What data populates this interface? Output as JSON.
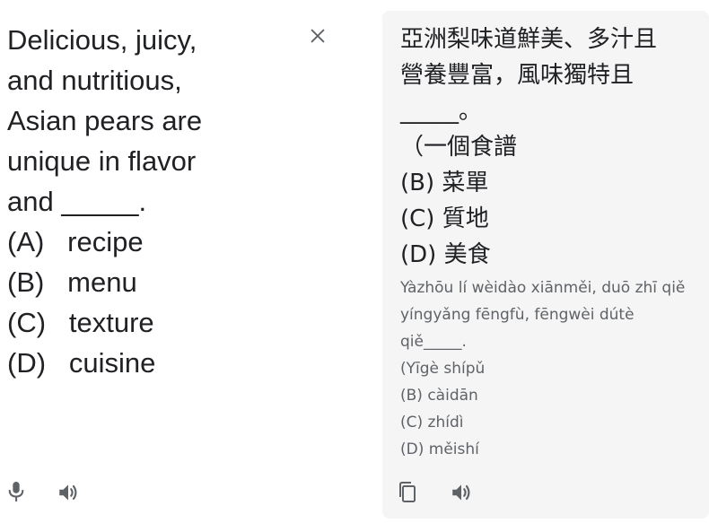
{
  "source": {
    "text": "Delicious, juicy,\nand nutritious,\nAsian pears are\nunique in flavor\nand _____.\n(A)   recipe\n(B)   menu\n(C)   texture\n(D)   cuisine"
  },
  "target": {
    "text": "亞洲梨味道鮮美、多汁且\n營養豐富，風味獨特且\n_____。\n（一個食譜\n(B) 菜單\n(C) 質地\n(D) 美食",
    "transliteration": "Yàzhōu lí wèidào xiānměi, duō zhī qiě\nyíngyǎng fēngfù, fēngwèi dútè\nqiě_____.\n(Yīgè shípǔ\n(B) càidān\n(C) zhídì\n(D) měishí"
  },
  "icons": {
    "clear": "close-icon",
    "mic": "microphone-icon",
    "source_speaker": "speaker-icon",
    "copy": "copy-icon",
    "target_speaker": "speaker-icon"
  },
  "colors": {
    "text": "#202124",
    "secondary_text": "#5f6368",
    "icon": "#5f6368",
    "target_panel_bg": "#f5f5f5"
  }
}
